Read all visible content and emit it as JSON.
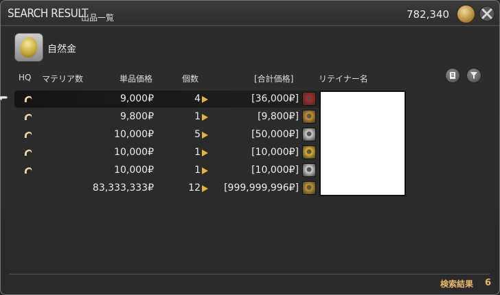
{
  "window": {
    "title_en": "SEARCH RESULT",
    "title_ja": "出品一覧",
    "gil": "782,340",
    "close_icon": "close-x-icon"
  },
  "item": {
    "name": "自然金",
    "icon": "gold-nugget-icon"
  },
  "columns": {
    "hq": "HQ",
    "materia": "マテリア数",
    "unit_price": "単品価格",
    "quantity": "個数",
    "total": "[合計価格]",
    "retainer": "リテイナー名"
  },
  "listings": [
    {
      "hq": true,
      "price": "9,000₽",
      "qty": "4",
      "total": "[36,000₽]",
      "city_icon": "red-city-icon",
      "city_color": "#b32222",
      "selected": true
    },
    {
      "hq": true,
      "price": "9,800₽",
      "qty": "1",
      "total": "[9,800₽]",
      "city_icon": "gold-crest-icon",
      "city_color": "#c8921f",
      "selected": false
    },
    {
      "hq": true,
      "price": "10,000₽",
      "qty": "5",
      "total": "[50,000₽]",
      "city_icon": "swirl-icon",
      "city_color": "#cfcfcf",
      "selected": false
    },
    {
      "hq": true,
      "price": "10,000₽",
      "qty": "1",
      "total": "[10,000₽]",
      "city_icon": "yellow-crest-icon",
      "city_color": "#e2b21f",
      "selected": false
    },
    {
      "hq": true,
      "price": "10,000₽",
      "qty": "1",
      "total": "[10,000₽]",
      "city_icon": "swirl-icon",
      "city_color": "#cfcfcf",
      "selected": false
    },
    {
      "hq": false,
      "price": "83,333,333₽",
      "qty": "12",
      "total": "[999,999,996₽]",
      "city_icon": "gold-crest-icon",
      "city_color": "#c8921f",
      "selected": false
    }
  ],
  "footer": {
    "label": "検索結果",
    "count": "6"
  }
}
